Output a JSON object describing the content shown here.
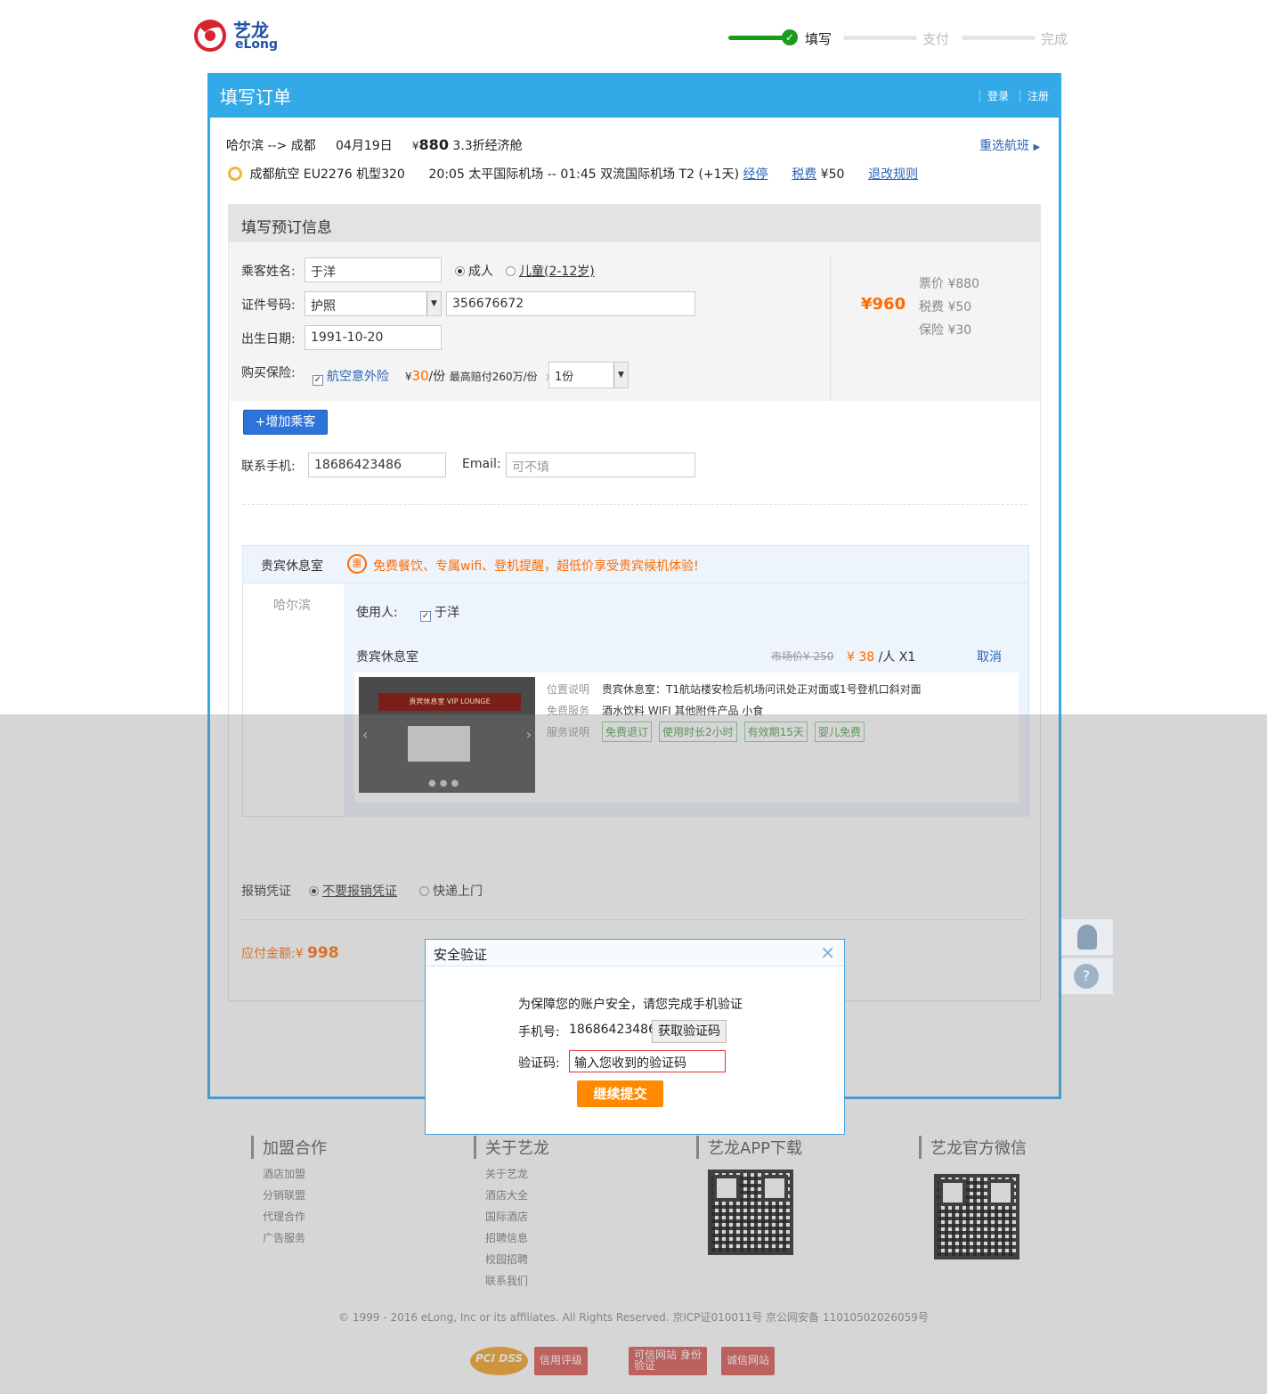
{
  "header": {
    "logo_cn": "艺龙",
    "logo_en": "eLong",
    "steps": [
      "填写",
      "支付",
      "完成"
    ]
  },
  "panel": {
    "title": "填写订单",
    "login": "登录",
    "register": "注册"
  },
  "flight": {
    "route": "哈尔滨 --> 成都",
    "date": "04月19日",
    "currency": "¥",
    "price": "880",
    "cabin": "3.3折经济舱",
    "reselect": "重选航班",
    "airline": "成都航空 EU2276",
    "plane": "机型320",
    "schedule": "20:05 太平国际机场  -- 01:45 双流国际机场 T2 (+1天)",
    "stop_link": "经停",
    "tax_link": "税费",
    "tax_value": "¥50",
    "rules_link": "退改规则"
  },
  "booking": {
    "title": "填写预订信息",
    "name_label": "乘客姓名:",
    "name_value": "于洋",
    "adult": "成人",
    "child": "儿童(2-12岁)",
    "id_label": "证件号码:",
    "id_type": "护照",
    "id_value": "356676672",
    "birth_label": "出生日期:",
    "birth_value": "1991-10-20",
    "insurance_label": "购买保险:",
    "insurance_name": "航空意外险",
    "insurance_price_prefix": "¥",
    "insurance_price": "30",
    "insurance_unit": "/份",
    "insurance_max": "最高赔付260万/份",
    "insurance_x": "x",
    "insurance_qty": "1份",
    "total": "¥960",
    "fare": "票价 ¥880",
    "tax": "税费 ¥50",
    "insurance_fee": "保险 ¥30",
    "add_passenger": "增加乘客",
    "phone_label": "联系手机:",
    "phone_value": "18686423486",
    "email_label": "Email:",
    "email_placeholder": "可不填"
  },
  "vip": {
    "title": "贵宾休息室",
    "promo_icon": "惠",
    "promo": "免费餐饮、专属wifi、登机提醒，超低价享受贵宾候机体验!",
    "city": "哈尔滨",
    "user_label": "使用人:",
    "user_name": "于洋",
    "room_name": "贵宾休息室",
    "market_price": "市场价¥ 250",
    "price": "¥ 38",
    "per": "/人",
    "qty": "X1",
    "cancel": "取消",
    "location_label": "位置说明",
    "location": "贵宾休息室：T1航站楼安检后机场问讯处正对面或1号登机口斜对面",
    "service_label": "免费服务",
    "service": "酒水饮料   WIFI   其他附件产品   小食",
    "notes_label": "服务说明",
    "tags": [
      "免费退订",
      "使用时长2小时",
      "有效期15天",
      "婴儿免费"
    ],
    "sign_text": "贵宾休息室  VIP LOUNGE"
  },
  "invoice": {
    "label": "报销凭证",
    "opt1": "不要报销凭证",
    "opt2": "快递上门"
  },
  "payment": {
    "label": "应付金额:",
    "amount_prefix": "¥",
    "amount": "998"
  },
  "footer": {
    "col1_title": "加盟合作",
    "col1": [
      "酒店加盟",
      "分销联盟",
      "代理合作",
      "广告服务"
    ],
    "col2_title": "关于艺龙",
    "col2": [
      "关于艺龙",
      "酒店大全",
      "国际酒店",
      "招聘信息",
      "校园招聘",
      "联系我们"
    ],
    "col3_title": "艺龙APP下载",
    "col4_title": "艺龙官方微信",
    "copyright": "© 1999 - 2016 eLong, Inc or its affiliates. All Rights Reserved. 京ICP证010011号 京公网安备 11010502026059号",
    "badges": [
      "信用评级",
      "可信网站 身份验证",
      "诚信网站"
    ],
    "pcidss": "PCI DSS"
  },
  "dialog": {
    "title": "安全验证",
    "message": "为保障您的账户安全，请您完成手机验证",
    "phone_label": "手机号:",
    "phone": "18686423486",
    "get_code": "获取验证码",
    "code_label": "验证码:",
    "code_value": "输入您收到的验证码",
    "submit": "继续提交"
  },
  "colors": {
    "primary": "#33a9e8",
    "accent": "#ff8a00",
    "step_done": "#1a9b1a"
  }
}
